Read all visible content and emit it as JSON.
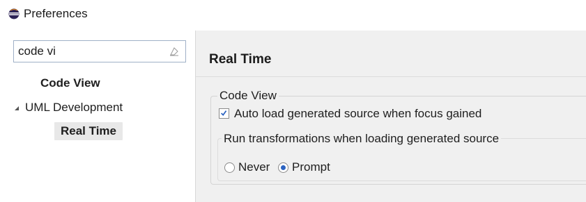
{
  "window": {
    "title": "Preferences"
  },
  "sidebar": {
    "search": {
      "value": "code vi",
      "placeholder": ""
    },
    "items": [
      {
        "label": "Code View",
        "bold": true
      },
      {
        "label": "UML Development",
        "expanded": true
      },
      {
        "label": "Real Time",
        "bold": true,
        "selected": true
      }
    ]
  },
  "page": {
    "title": "Real Time",
    "group": {
      "label": "Code View",
      "checkbox": {
        "label": "Auto load generated source when focus gained",
        "checked": true
      },
      "subgroup": {
        "label": "Run transformations when loading generated source",
        "options": [
          {
            "label": "Never",
            "selected": false
          },
          {
            "label": "Prompt",
            "selected": true
          }
        ]
      }
    }
  },
  "colors": {
    "accent": "#2b63c1",
    "panel_bg": "#f0f0f0"
  },
  "icons": {
    "app": "eclipse-icon",
    "clear": "clear-search-icon",
    "expand": "expand-arrow-icon",
    "check": "checkmark-icon"
  }
}
